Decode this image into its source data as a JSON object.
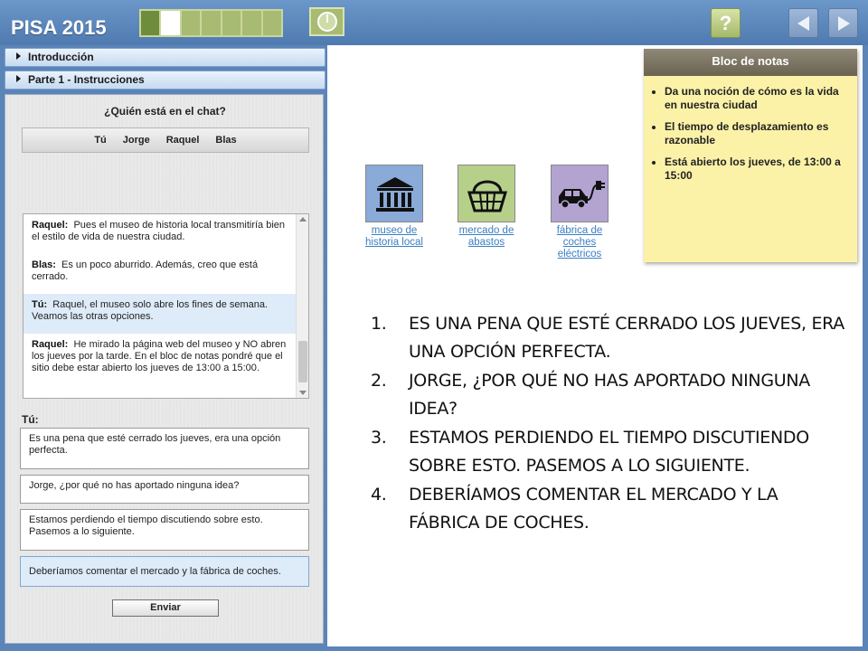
{
  "app": {
    "title": "PISA 2015"
  },
  "header": {
    "progress": {
      "total_segments": 7,
      "completed": 1,
      "current": 2
    },
    "help_label": "?"
  },
  "sidebar": {
    "sections": [
      {
        "label": "Introducción"
      },
      {
        "label": "Parte 1 - Instrucciones"
      }
    ]
  },
  "chat": {
    "heading": "¿Quién está en el chat?",
    "participants": [
      "Tú",
      "Jorge",
      "Raquel",
      "Blas"
    ],
    "history": [
      {
        "speaker": "Raquel:",
        "text": "Pues el museo de historia local transmitiría bien el estilo de vida de nuestra ciudad.",
        "highlight": false
      },
      {
        "speaker": "Blas:",
        "text": "Es un poco aburrido. Además, creo que está cerrado.",
        "highlight": false
      },
      {
        "speaker": "Tú:",
        "text": "Raquel, el museo solo abre los fines de semana. Veamos las otras opciones.",
        "highlight": true
      },
      {
        "speaker": "Raquel:",
        "text": "He mirado la página web del museo y NO abren los jueves por la tarde. En el bloc de notas pondré que el sitio debe estar abierto los jueves de 13:00 a 15:00.",
        "highlight": false
      }
    ],
    "you_label": "Tú:",
    "options": [
      "Es una pena que esté cerrado los jueves, era una opción perfecta.",
      "Jorge, ¿por qué no has aportado ninguna idea?",
      "Estamos perdiendo el tiempo discutiendo sobre esto. Pasemos a lo siguiente.",
      "Deberíamos comentar el mercado y la fábrica de coches."
    ],
    "selected_option": 3,
    "send_label": "Enviar"
  },
  "sites": [
    {
      "name": "museo de historia local",
      "icon": "museum-icon",
      "color": "#8aaad8"
    },
    {
      "name": "mercado de abastos",
      "icon": "basket-icon",
      "color": "#b6d08a"
    },
    {
      "name": "fábrica de coches eléctricos",
      "icon": "electric-car-icon",
      "color": "#b3a3d1"
    }
  ],
  "notepad": {
    "title": "Bloc de notas",
    "items": [
      "Da una noción de cómo es la vida en nuestra ciudad",
      "El tiempo de desplazamiento es razonable",
      "Está abierto los jueves, de 13:00 a 15:00"
    ]
  },
  "overlay_list": [
    {
      "num": "1.",
      "text": "ES UNA PENA QUE ESTÉ CERRADO LOS JUEVES, ERA UNA OPCIÓN PERFECTA."
    },
    {
      "num": "2.",
      "text": "JORGE, ¿POR QUÉ NO HAS APORTADO NINGUNA IDEA?"
    },
    {
      "num": "3.",
      "text": "ESTAMOS PERDIENDO EL TIEMPO DISCUTIENDO SOBRE ESTO. PASEMOS A LO SIGUIENTE."
    },
    {
      "num": "4.",
      "text": "DEBERÍAMOS COMENTAR EL MERCADO Y LA FÁBRICA DE COCHES."
    }
  ]
}
